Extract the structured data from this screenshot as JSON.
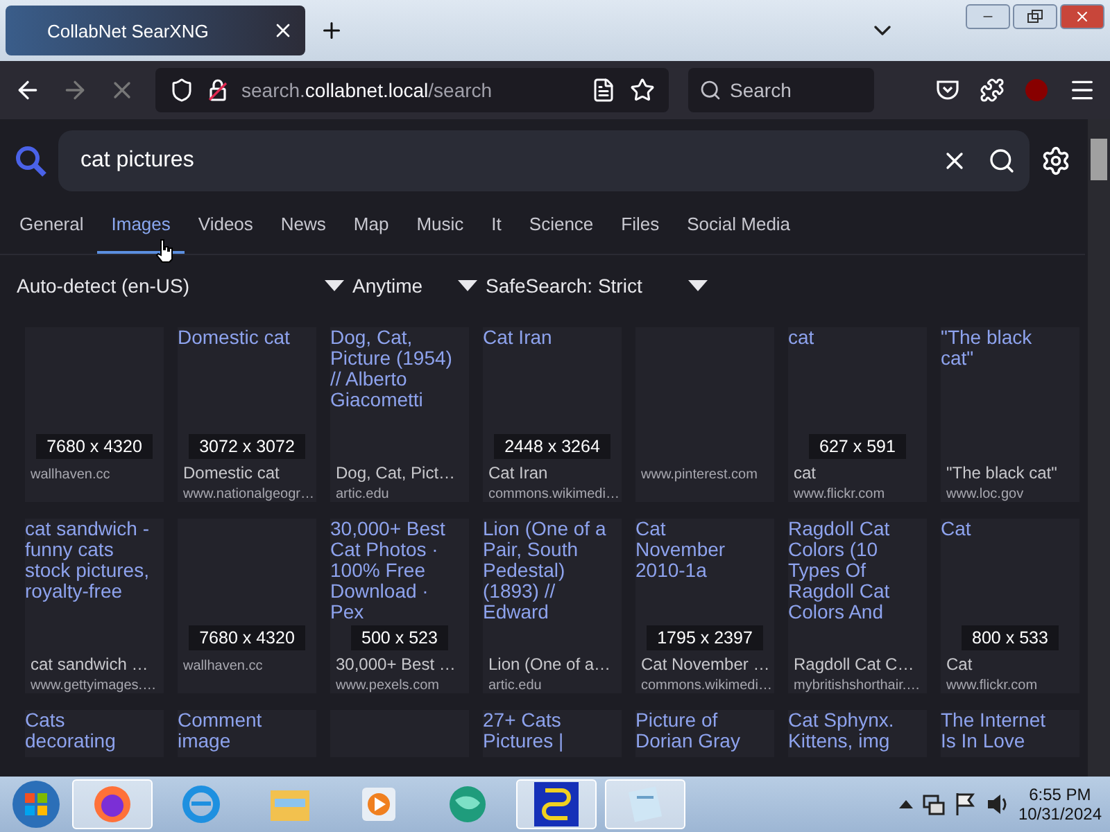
{
  "browser": {
    "tab": {
      "title": "CollabNet SearXNG",
      "selected": true
    },
    "url": [
      {
        "text": "search.",
        "kind": "dim"
      },
      {
        "text": "collabnet.local",
        "kind": "bright"
      },
      {
        "text": "/search",
        "kind": "dim"
      }
    ],
    "search_placeholder": "Search"
  },
  "search": {
    "query": "cat pictures"
  },
  "categories": [
    {
      "label": "General",
      "selected": false
    },
    {
      "label": "Images",
      "selected": true
    },
    {
      "label": "Videos",
      "selected": false
    },
    {
      "label": "News",
      "selected": false
    },
    {
      "label": "Map",
      "selected": false
    },
    {
      "label": "Music",
      "selected": false
    },
    {
      "label": "It",
      "selected": false
    },
    {
      "label": "Science",
      "selected": false
    },
    {
      "label": "Files",
      "selected": false
    },
    {
      "label": "Social Media",
      "selected": false
    }
  ],
  "filters": [
    {
      "value": "Auto-detect (en-US)"
    },
    {
      "value": "Anytime"
    },
    {
      "value": "SafeSearch: Strict"
    }
  ],
  "results": [
    {
      "size": "7680 x 4320",
      "url": "wallhaven.cc"
    },
    {
      "title": "Domestic cat",
      "size": "3072 x 3072",
      "caption": "Domestic cat",
      "url": "www.nationalgeogr…"
    },
    {
      "title": "Dog, Cat, Picture (1954) // Alberto Giacometti",
      "caption": "Dog, Cat, Pict…",
      "url": "artic.edu"
    },
    {
      "title": "Cat Iran",
      "size": "2448 x 3264",
      "caption": "Cat Iran",
      "url": "commons.wikimedi…"
    },
    {
      "url": "www.pinterest.com"
    },
    {
      "title": "cat",
      "size": "627 x 591",
      "caption": "cat",
      "url": "www.flickr.com"
    },
    {
      "title": "\"The black cat\"",
      "caption": "\"The black cat\"",
      "url": "www.loc.gov"
    },
    {
      "title": "cat sandwich - funny cats stock pictures, royalty-free",
      "caption": "cat sandwich …",
      "url": "www.gettyimages.…"
    },
    {
      "size": "7680 x 4320",
      "url": "wallhaven.cc"
    },
    {
      "title": "30,000+ Best Cat Photos · 100% Free Download · Pex",
      "size": "500 x 523",
      "caption": "30,000+ Best …",
      "url": "www.pexels.com"
    },
    {
      "title": "Lion (One of a Pair, South Pedestal) (1893) // Edward",
      "caption": "Lion (One of a…",
      "url": "artic.edu"
    },
    {
      "title": "Cat November 2010-1a",
      "size": "1795 x 2397",
      "caption": "Cat November …",
      "url": "commons.wikimedi…"
    },
    {
      "title": "Ragdoll Cat Colors (10 Types Of Ragdoll Cat Colors And",
      "caption": "Ragdoll Cat C…",
      "url": "mybritishshorthair.…"
    },
    {
      "title": "Cat",
      "size": "800 x 533",
      "caption": "Cat",
      "url": "www.flickr.com"
    },
    {
      "kind": "partial",
      "title": "Cats decorating"
    },
    {
      "kind": "partial",
      "title": "Comment image"
    },
    {
      "kind": "partial"
    },
    {
      "kind": "partial",
      "title": "27+ Cats Pictures |"
    },
    {
      "kind": "partial",
      "title": "Picture of Dorian Gray"
    },
    {
      "kind": "partial",
      "title": "Cat Sphynx. Kittens, img"
    },
    {
      "kind": "partial",
      "title": "The Internet Is In Love"
    }
  ],
  "taskbar": {
    "apps": [
      {
        "kind": "firefox",
        "selected": true
      },
      {
        "kind": "ie",
        "selected": false
      },
      {
        "kind": "folder",
        "selected": false
      },
      {
        "kind": "media",
        "selected": false
      },
      {
        "kind": "globe",
        "selected": false
      },
      {
        "kind": "cable",
        "selected": true
      },
      {
        "kind": "notepad",
        "selected": true
      }
    ],
    "time": "6:55 PM",
    "date": "10/31/2024"
  }
}
